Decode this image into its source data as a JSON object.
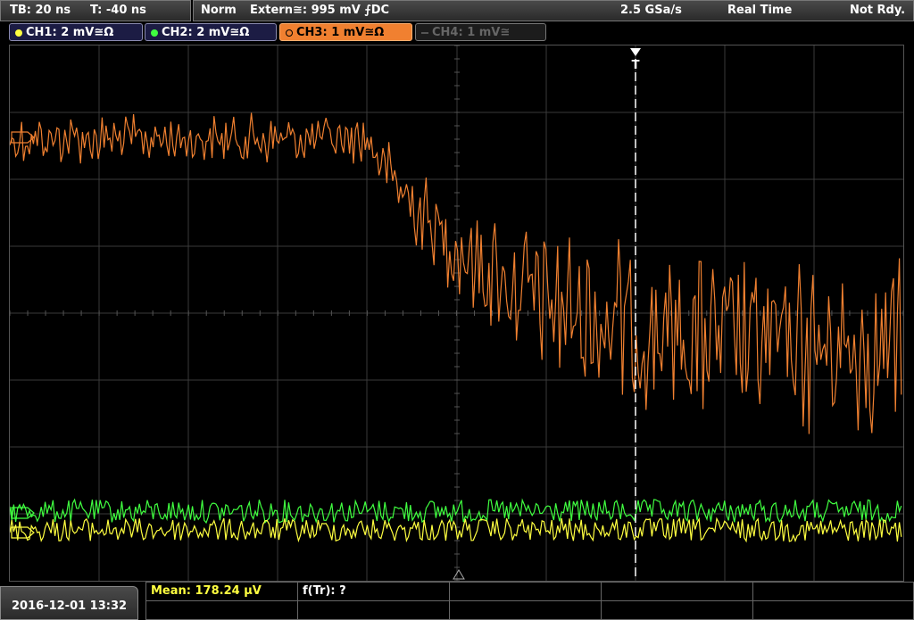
{
  "topbar": {
    "timebase": "TB: 20 ns",
    "trigger_time": "T: -40 ns",
    "mode": "Norm",
    "trigger_source": "Extern≅: 995 mV ⨍DC",
    "sample_rate": "2.5 GSa/s",
    "acquisition": "Real Time",
    "status": "Not Rdy."
  },
  "channels": [
    {
      "label": "CH1: 2 mV≅Ω",
      "color": "#ffff40"
    },
    {
      "label": "CH2: 2 mV≅Ω",
      "color": "#40ff40"
    },
    {
      "label": "CH3: 1 mV≅Ω",
      "color": "#f08030"
    },
    {
      "label": "CH4: 1 mV≅",
      "color": "#555555"
    }
  ],
  "markers": {
    "trigger": "T"
  },
  "bottom": {
    "datetime": "2016-12-01 13:32",
    "mean": "Mean: 178.24 µV",
    "ftr": "f(Tr): ?"
  },
  "colors": {
    "ch1": "#ffff40",
    "ch2": "#40ff40",
    "ch3": "#f08030",
    "grid": "#3a3a3a"
  }
}
